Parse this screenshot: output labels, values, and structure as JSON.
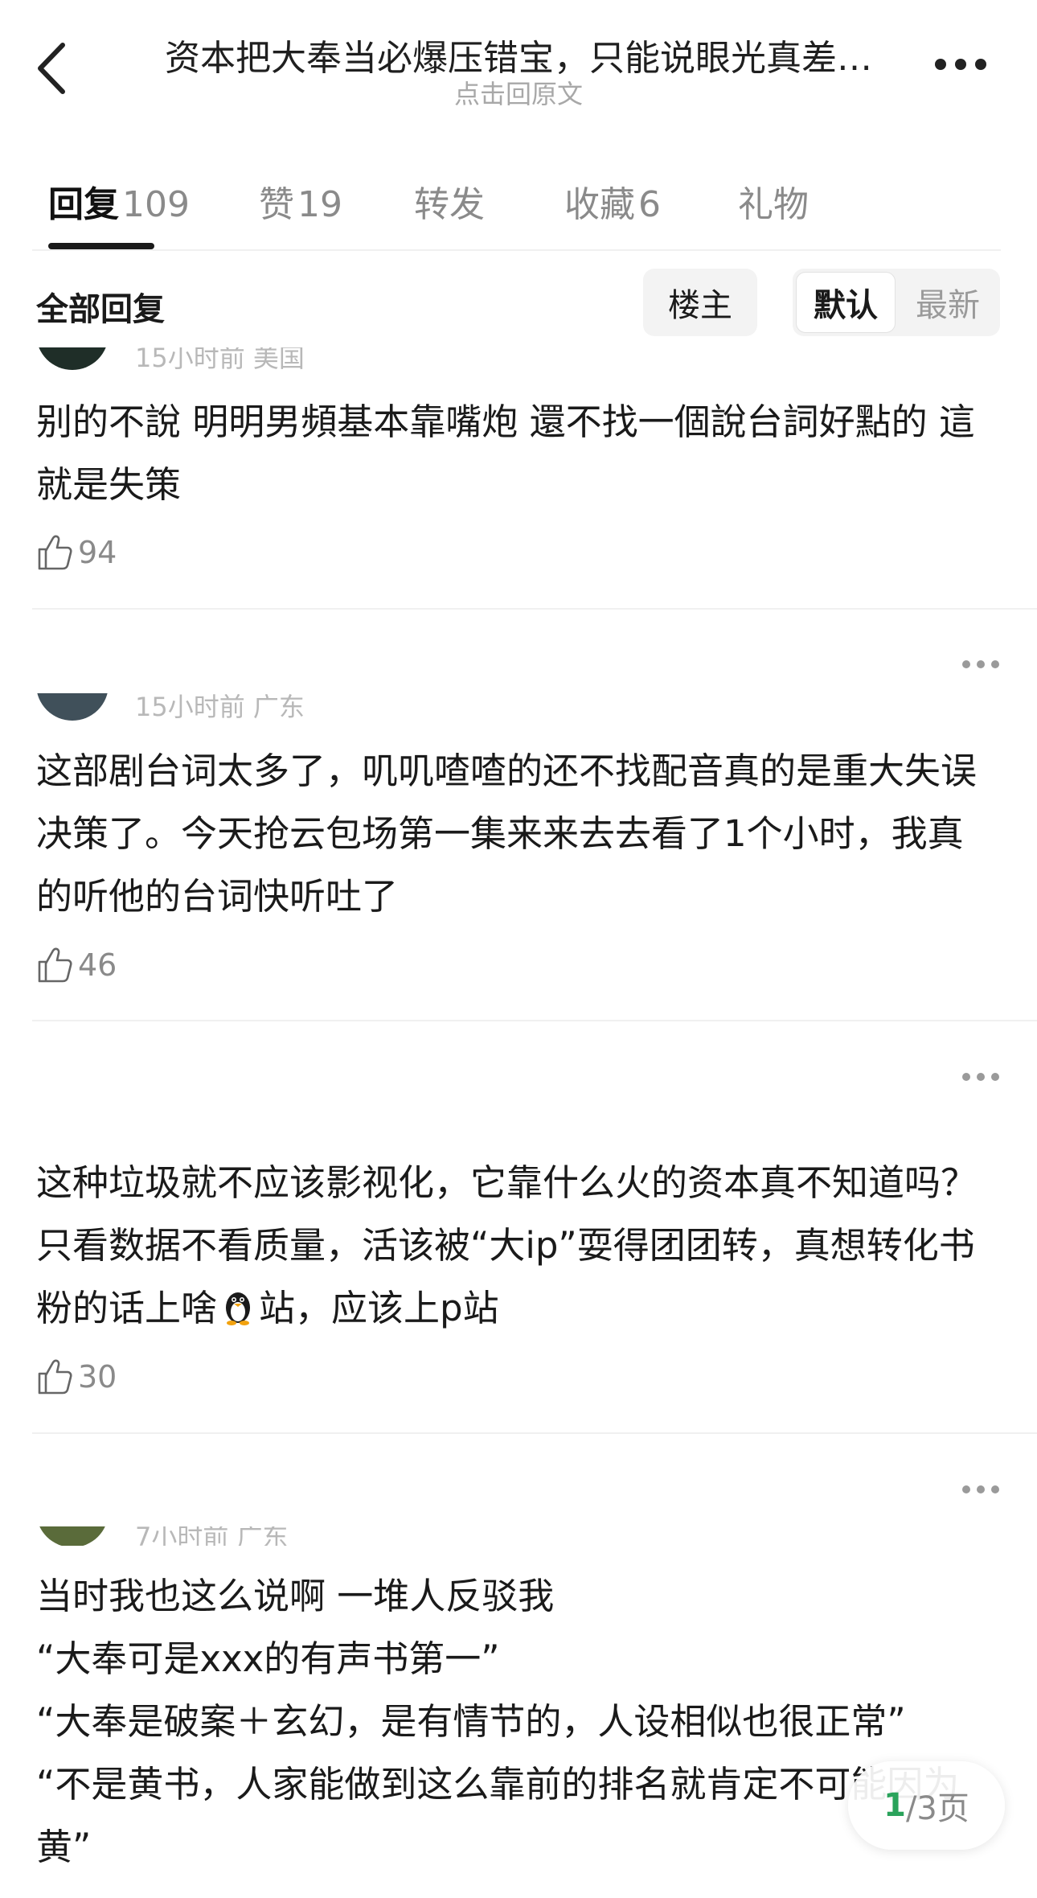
{
  "header": {
    "title": "资本把大奉当必爆压错宝，只能说眼光真差…",
    "subtitle": "点击回原文"
  },
  "tabs": [
    {
      "label": "回复",
      "count": "109"
    },
    {
      "label": "赞",
      "count": "19"
    },
    {
      "label": "转发",
      "count": ""
    },
    {
      "label": "收藏",
      "count": "6"
    },
    {
      "label": "礼物",
      "count": ""
    }
  ],
  "filter": {
    "all_replies": "全部回复",
    "op_only": "楼主",
    "sort_default": "默认",
    "sort_latest": "最新"
  },
  "comments": [
    {
      "meta": "15小时前 美国",
      "text": "别的不說 明明男頻基本靠嘴炮 還不找一個說台詞好點的 這就是失策",
      "likes": "94"
    },
    {
      "meta": "15小时前 广东",
      "text": "这部剧台词太多了，叽叽喳喳的还不找配音真的是重大失误决策了。今天抢云包场第一集来来去去看了1个小时，我真的听他的台词快听吐了",
      "likes": "46"
    },
    {
      "meta": "",
      "text_before": "这种垃圾就不应该影视化，它靠什么火的资本真不知道吗？只看数据不看质量，活该被“大ip”耍得团团转，真想转化书粉的话上啥",
      "text_after": "站，应该上p站",
      "likes": "30"
    },
    {
      "meta": "7小时前 广东",
      "lines": [
        "当时我也这么说啊 一堆人反驳我",
        "“大奉可是xxx的有声书第一”",
        "“大奉是破案＋玄幻，是有情节的，人设相似也很正常”",
        "“不是黄书，人家能做到这么靠前的排名就肯定不可能因为黄”"
      ]
    }
  ],
  "pagination": {
    "current": "1",
    "total": "/3页"
  }
}
